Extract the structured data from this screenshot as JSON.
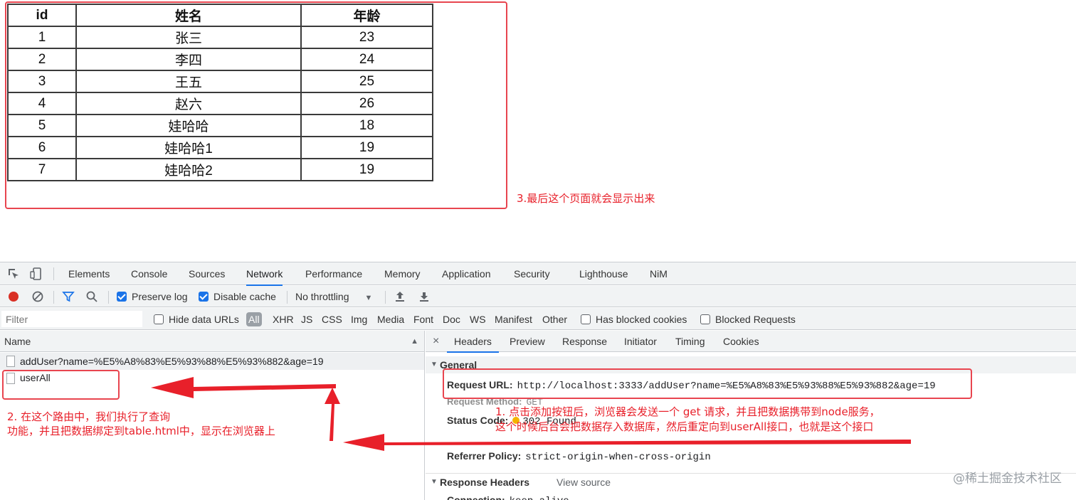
{
  "table": {
    "headers": [
      "id",
      "姓名",
      "年龄"
    ],
    "rows": [
      [
        "1",
        "张三",
        "23"
      ],
      [
        "2",
        "李四",
        "24"
      ],
      [
        "3",
        "王五",
        "25"
      ],
      [
        "4",
        "赵六",
        "26"
      ],
      [
        "5",
        "娃哈哈",
        "18"
      ],
      [
        "6",
        "娃哈哈1",
        "19"
      ],
      [
        "7",
        "娃哈哈2",
        "19"
      ]
    ]
  },
  "annotations": {
    "a3": "3.最后这个页面就会显示出来",
    "a2_line1": "2. 在这个路由中，我们执行了查询",
    "a2_line2": "功能，并且把数据绑定到table.html中，显示在浏览器上",
    "a1_line1": "1. 点击添加按钮后，浏览器会发送一个 get 请求，并且把数据携带到node服务，",
    "a1_line2": "这个时候后台会把数据存入数据库，然后重定向到userAll接口，也就是这个接口"
  },
  "devtools": {
    "tabs": [
      "Elements",
      "Console",
      "Sources",
      "Network",
      "Performance",
      "Memory",
      "Application",
      "Security",
      "Lighthouse",
      "NiM"
    ],
    "active_tab": "Network",
    "toolbar": {
      "preserve_log": "Preserve log",
      "disable_cache": "Disable cache",
      "throttling": "No throttling"
    },
    "filter": {
      "placeholder": "Filter",
      "hide_data_urls": "Hide data URLs",
      "types": [
        "All",
        "XHR",
        "JS",
        "CSS",
        "Img",
        "Media",
        "Font",
        "Doc",
        "WS",
        "Manifest",
        "Other"
      ],
      "has_blocked_cookies": "Has blocked cookies",
      "blocked_requests": "Blocked Requests"
    },
    "requests": {
      "column_name": "Name",
      "items": [
        "addUser?name=%E5%A8%83%E5%93%88%E5%93%882&age=19",
        "userAll"
      ]
    },
    "detail": {
      "close": "×",
      "tabs": [
        "Headers",
        "Preview",
        "Response",
        "Initiator",
        "Timing",
        "Cookies"
      ],
      "general_title": "General",
      "request_url_label": "Request URL:",
      "request_url": "http://localhost:3333/addUser?name=%E5%A8%83%E5%93%88%E5%93%882&age=19",
      "request_method_label": "Request Method:",
      "request_method": "GET",
      "status_code_label": "Status Code:",
      "status_code": "302 Found",
      "referrer_policy_label": "Referrer Policy:",
      "referrer_policy": "strict-origin-when-cross-origin",
      "response_headers_title": "Response Headers",
      "view_source": "View source",
      "connection_label": "Connection:",
      "connection": "keep-alive"
    }
  },
  "watermark": "@稀土掘金技术社区",
  "colors": {
    "annotation_red": "#e8202a",
    "accent_blue": "#1a73e8",
    "record_red": "#d93025"
  }
}
